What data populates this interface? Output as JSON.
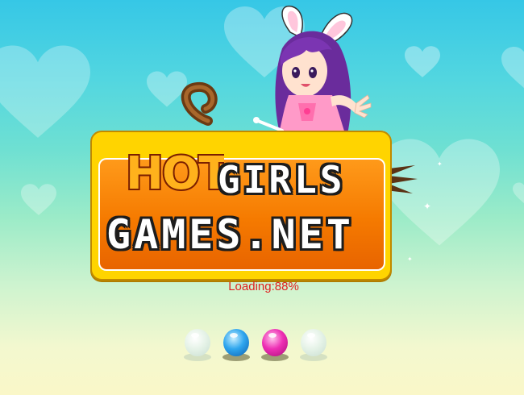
{
  "logo": {
    "hot": "HOT",
    "line1": "GIRLS",
    "line2": "GAMES.NET"
  },
  "loading": {
    "label": "Loading:88%",
    "progress_percent": 88
  },
  "progress_orbs": [
    {
      "state": "inactive",
      "color": "#e6f3e8"
    },
    {
      "state": "active",
      "color": "#2fa6ee"
    },
    {
      "state": "active",
      "color": "#ee2fb4"
    },
    {
      "state": "inactive",
      "color": "#e6f3e8"
    }
  ],
  "colors": {
    "sky_top": "#36c7e6",
    "sky_bottom": "#faf7c8",
    "logo_plate": "#ffd400",
    "logo_inner": "#f57a00",
    "loading_text": "#e02020"
  }
}
